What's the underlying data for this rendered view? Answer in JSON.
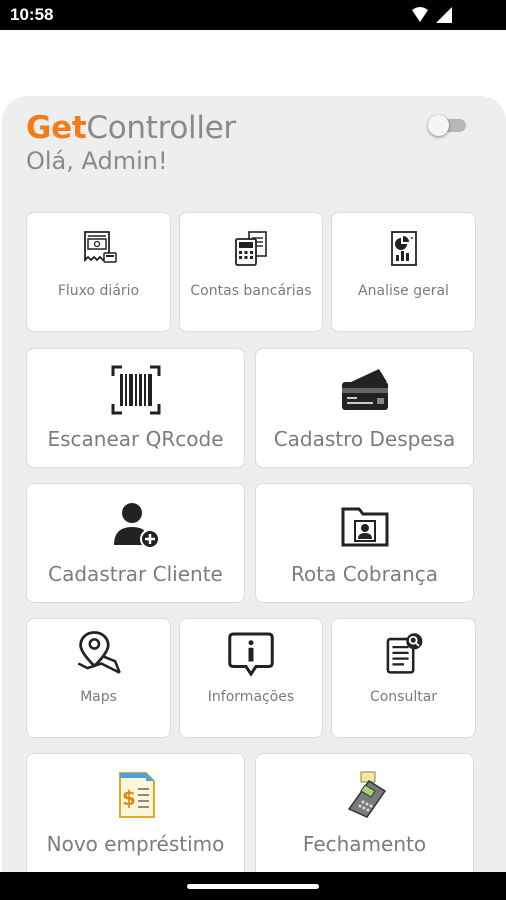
{
  "status": {
    "time": "10:58"
  },
  "brand": {
    "get": "Get",
    "controller": "Controller"
  },
  "greeting": "Olá, Admin!",
  "tiles": [
    {
      "label": "Fluxo diário",
      "icon": "cash-receipt-icon"
    },
    {
      "label": "Contas bancárias",
      "icon": "calculator-documents-icon"
    },
    {
      "label": "Analise geral",
      "icon": "report-chart-icon"
    },
    {
      "label": "Escanear QRcode",
      "icon": "barcode-scan-icon"
    },
    {
      "label": "Cadastro Despesa",
      "icon": "credit-card-icon"
    },
    {
      "label": "Cadastrar Cliente",
      "icon": "add-user-icon"
    },
    {
      "label": "Rota Cobrança",
      "icon": "contact-folder-icon"
    },
    {
      "label": "Maps",
      "icon": "map-pin-icon"
    },
    {
      "label": "Informações",
      "icon": "info-bubble-icon"
    },
    {
      "label": "Consultar",
      "icon": "document-search-icon"
    },
    {
      "label": "Novo empréstimo",
      "icon": "loan-document-icon"
    },
    {
      "label": "Fechamento",
      "icon": "card-terminal-icon"
    }
  ]
}
